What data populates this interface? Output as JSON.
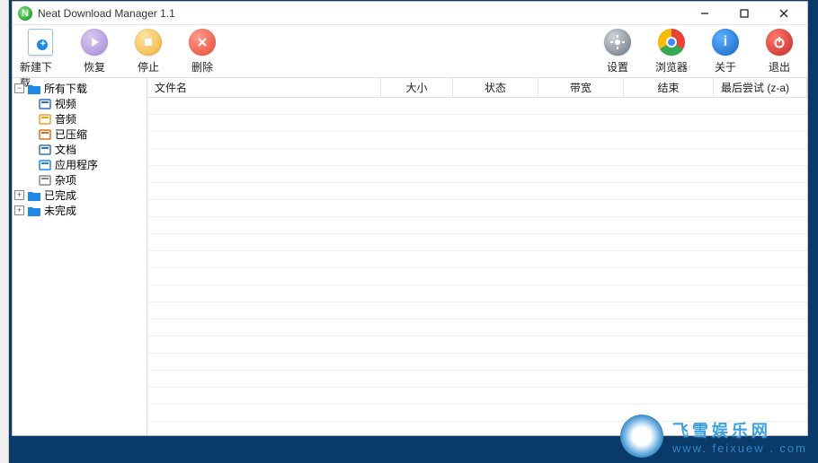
{
  "title": "Neat Download Manager 1.1",
  "toolbar_left": [
    {
      "name": "new-download",
      "label": "新建下载"
    },
    {
      "name": "resume",
      "label": "恢复"
    },
    {
      "name": "stop",
      "label": "停止"
    },
    {
      "name": "delete",
      "label": "删除"
    }
  ],
  "toolbar_right": [
    {
      "name": "settings",
      "label": "设置"
    },
    {
      "name": "browser",
      "label": "浏览器"
    },
    {
      "name": "about",
      "label": "关于"
    },
    {
      "name": "exit",
      "label": "退出"
    }
  ],
  "tree": {
    "all": "所有下载",
    "cats": [
      "视频",
      "音频",
      "已压缩",
      "文档",
      "应用程序",
      "杂项"
    ],
    "done": "已完成",
    "undone": "未完成"
  },
  "columns": {
    "name": "文件名",
    "size": "大小",
    "status": "状态",
    "bandwidth": "带宽",
    "end": "结束",
    "last": "最后尝试 (z-a)"
  },
  "watermark": {
    "line1": "飞雪娱乐网",
    "line2": "www. feixuew . com"
  },
  "cat_icon_colors": [
    "#2d6ec9",
    "#f0a020",
    "#e26b1a",
    "#3c6fb5",
    "#1e88e5",
    "#888"
  ]
}
